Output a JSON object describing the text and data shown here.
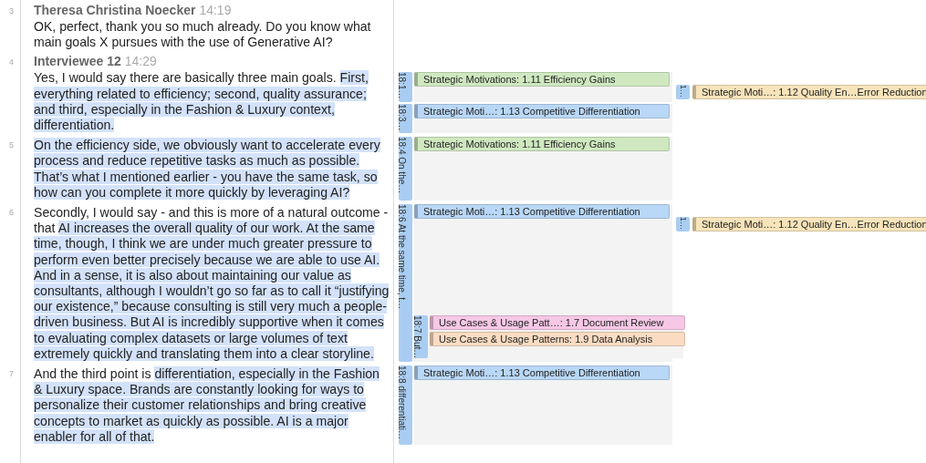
{
  "paragraphs": [
    {
      "number": "3",
      "speaker": "Theresa Christina Noecker",
      "time": "14:19",
      "spans": [
        {
          "text": "OK, perfect, thank you so much already. Do you know what main goals X pursues with the use of Generative AI?",
          "highlighted": false
        }
      ]
    },
    {
      "number": "4",
      "speaker": "Interviewee 12",
      "time": "14:29",
      "spans": [
        {
          "text": "Yes, I would say there are basically three main goals. ",
          "highlighted": false
        },
        {
          "text": "First, everything related to efficiency; ",
          "highlighted": true
        },
        {
          "text": "second, quality assurance; and third, especially in the Fashion & Luxury context, differentiation.",
          "highlighted": true
        }
      ],
      "segments": [
        {
          "label": "18:1…",
          "codes": [
            {
              "name": "Strategic Motivations: 1.11 Efficiency Gains",
              "color": "#cfe8c0"
            }
          ],
          "side": {
            "label": "1…",
            "code": {
              "name": "Strategic Moti…: 1.12 Quality En…Error Reduction",
              "color": "#f8e4bb"
            }
          }
        },
        {
          "label": "18:3…",
          "codes": [
            {
              "name": "Strategic Moti…: 1.13 Competitive Differentiation",
              "color": "#b9d7f7"
            }
          ]
        }
      ]
    },
    {
      "number": "5",
      "spans": [
        {
          "text": "On the efficiency side, we obviously want to accelerate every process and reduce repetitive tasks as much as possible. That’s what I mentioned earlier - you have the same task, so how can you complete it more quickly by leveraging AI?",
          "highlighted": true
        }
      ],
      "segments": [
        {
          "label": "18:4 On the…",
          "codes": [
            {
              "name": "Strategic Motivations: 1.11 Efficiency Gains",
              "color": "#cfe8c0"
            }
          ]
        }
      ]
    },
    {
      "number": "6",
      "spans": [
        {
          "text": "Secondly, I would say - and this is more of a natural outcome - that ",
          "highlighted": false
        },
        {
          "text": "AI increases the overall quality of our work. ",
          "highlighted": true
        },
        {
          "text": "At the same time, though, I think we are under much greater pressure to perform even better precisely because we are able to use AI. And in a sense, it is also about maintaining our value as consultants, although I wouldn’t go so far as to call it “justifying our existence,” because consulting is still very much a people-driven business. ",
          "highlighted": true
        },
        {
          "text": "But AI is incredibly supportive when it comes to evaluating complex datasets or large volumes of text extremely quickly and translating them into a clear storyline.",
          "highlighted": true
        }
      ],
      "segments": [
        {
          "label": "18:6 At the same time, t…",
          "codes": [
            {
              "name": "Strategic Moti…: 1.13 Competitive Differentiation",
              "color": "#b9d7f7"
            }
          ],
          "side": {
            "label": "1…",
            "code": {
              "name": "Strategic Moti…: 1.12 Quality En…Error Reduction",
              "color": "#f8e4bb"
            }
          },
          "children": [
            {
              "label": "18:7 But…",
              "codes": [
                {
                  "name": "Use Cases & Usage Patt…: 1.7 Document Review",
                  "color": "#f7c8e6"
                },
                {
                  "name": "Use Cases & Usage Patterns: 1.9 Data Analysis",
                  "color": "#fbdcc2"
                }
              ]
            }
          ]
        }
      ]
    },
    {
      "number": "7",
      "spans": [
        {
          "text": "And the third point is ",
          "highlighted": false
        },
        {
          "text": "differentiation, especially in the Fashion & Luxury space. Brands are constantly looking for ways to personalize their customer relationships and bring creative concepts to market as quickly as possible. AI is a major enabler for all of that.",
          "highlighted": true
        }
      ],
      "segments": [
        {
          "label": "18:8 differentiati…",
          "codes": [
            {
              "name": "Strategic Moti…: 1.13 Competitive Differentiation",
              "color": "#b9d7f7"
            }
          ]
        }
      ]
    }
  ]
}
